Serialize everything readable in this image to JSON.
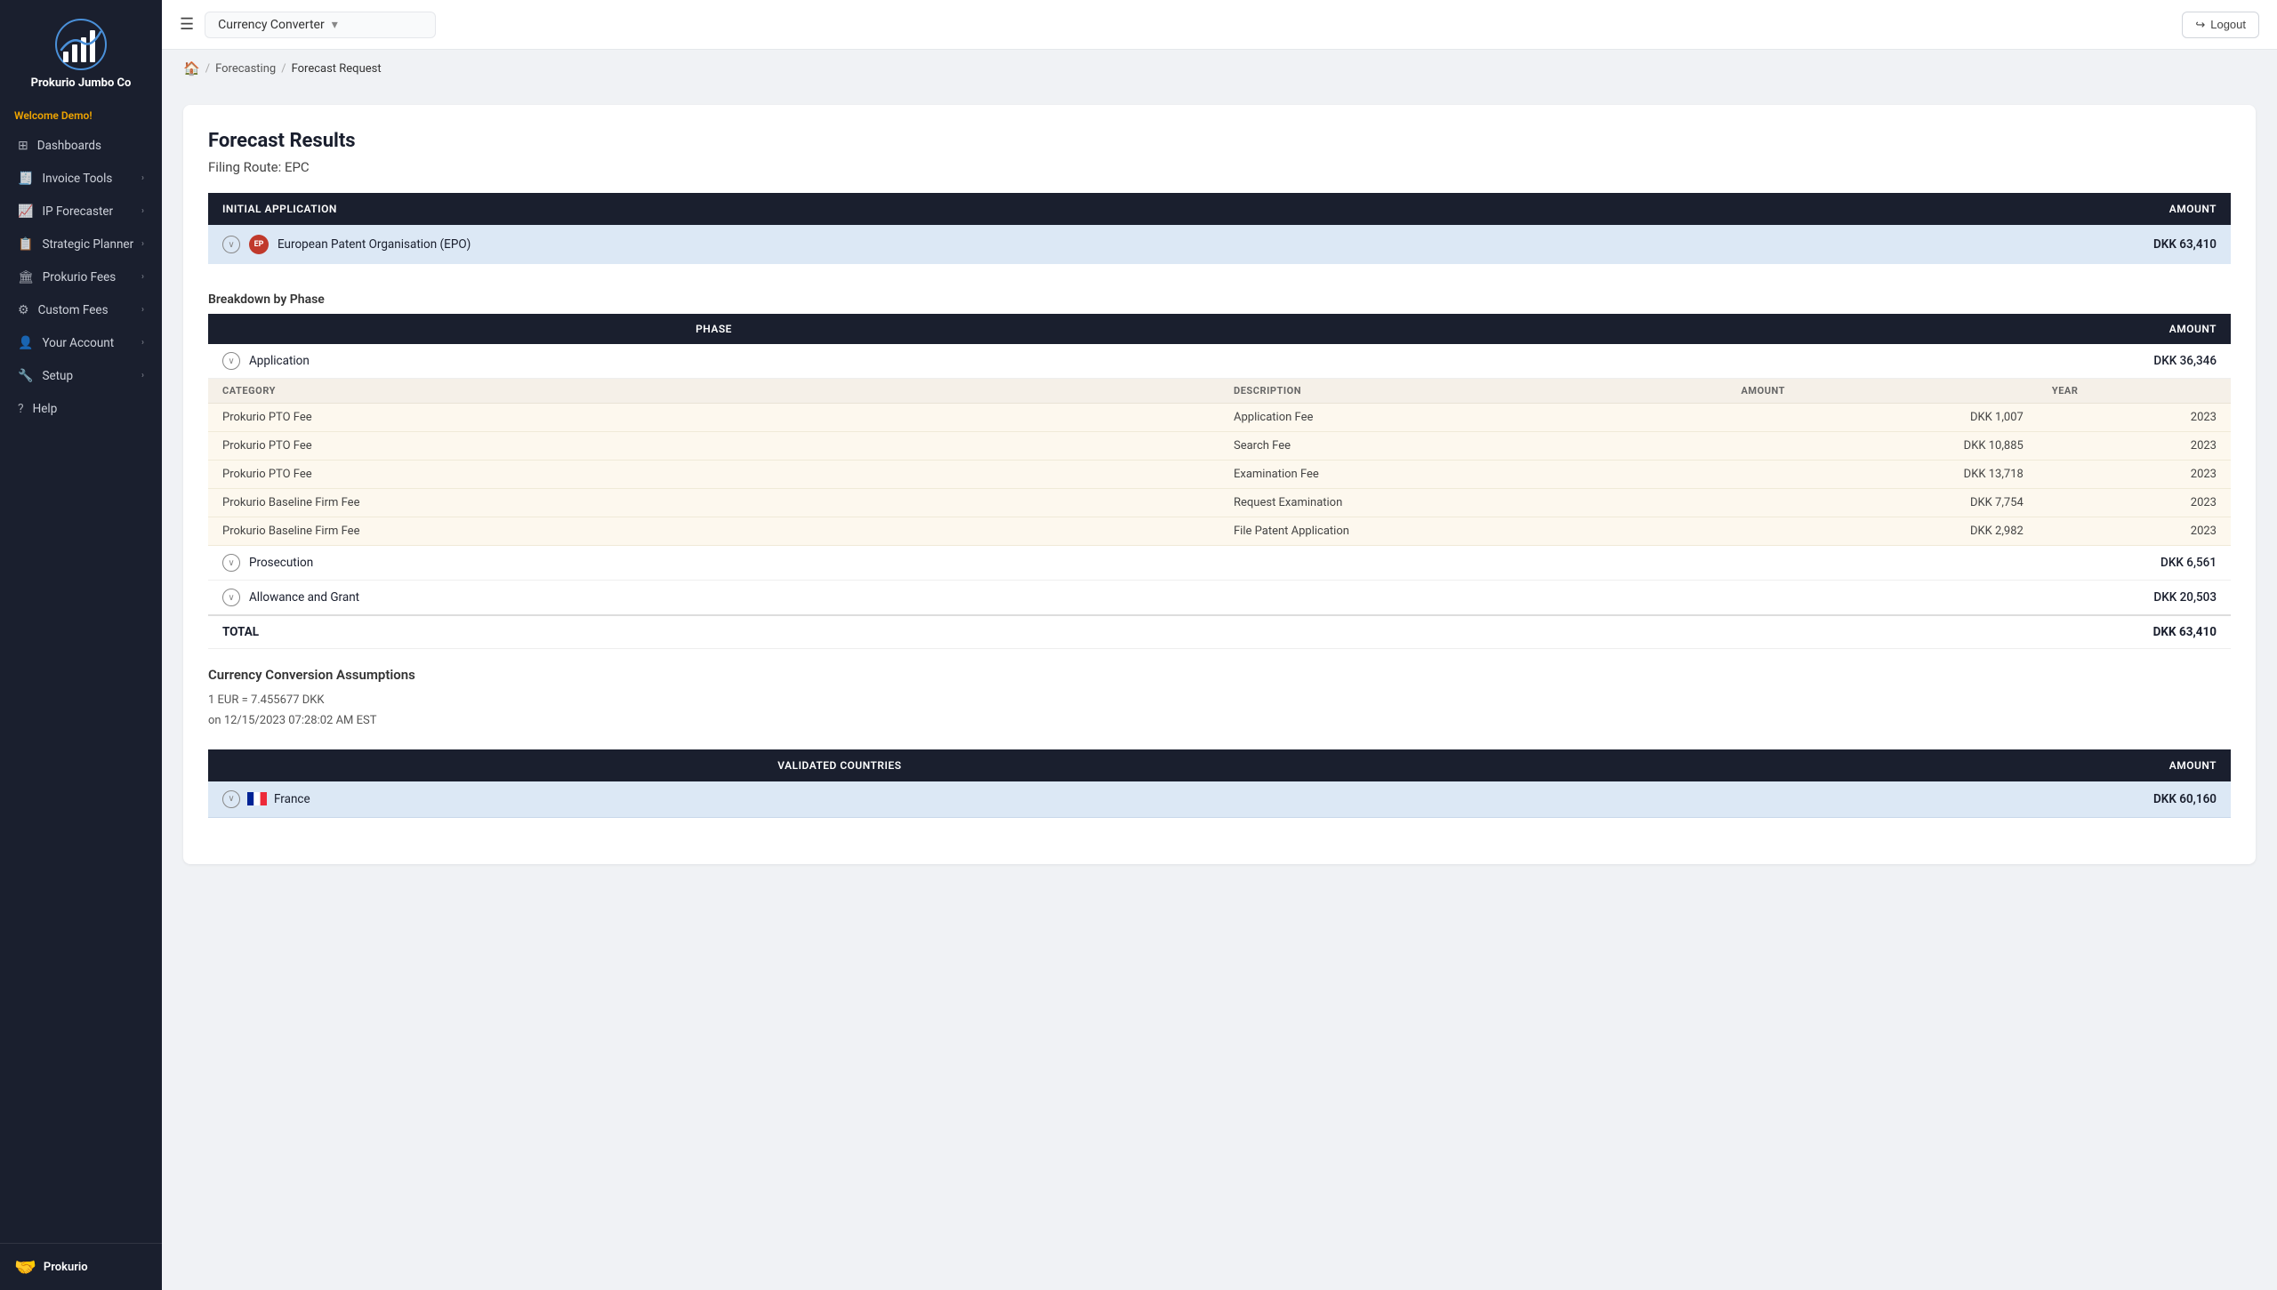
{
  "sidebar": {
    "logo_text": "Prokurio\nJumbo Co",
    "welcome": "Welcome Demo!",
    "items": [
      {
        "id": "dashboards",
        "label": "Dashboards",
        "icon": "⊞",
        "hasChevron": false
      },
      {
        "id": "invoice-tools",
        "label": "Invoice Tools",
        "icon": "🧾",
        "hasChevron": true
      },
      {
        "id": "ip-forecaster",
        "label": "IP Forecaster",
        "icon": "📈",
        "hasChevron": true
      },
      {
        "id": "strategic-planner",
        "label": "Strategic Planner",
        "icon": "📋",
        "hasChevron": true
      },
      {
        "id": "prokurio-fees",
        "label": "Prokurio Fees",
        "icon": "🏛",
        "hasChevron": true
      },
      {
        "id": "custom-fees",
        "label": "Custom Fees",
        "icon": "⚙",
        "hasChevron": true
      },
      {
        "id": "your-account",
        "label": "Your Account",
        "icon": "👤",
        "hasChevron": true
      },
      {
        "id": "setup",
        "label": "Setup",
        "icon": "🔧",
        "hasChevron": true
      },
      {
        "id": "help",
        "label": "Help",
        "icon": "?",
        "hasChevron": false
      }
    ],
    "bottom_label": "Prokurio"
  },
  "topbar": {
    "title": "Currency Converter",
    "logout_label": "Logout"
  },
  "breadcrumb": {
    "home_icon": "🏠",
    "forecasting": "Forecasting",
    "current": "Forecast Request"
  },
  "page": {
    "title": "Forecast Results",
    "filing_route": "Filing Route: EPC",
    "initial_application_header": "INITIAL APPLICATION",
    "amount_header": "AMOUNT",
    "epo_label": "European Patent Organisation (EPO)",
    "epo_amount": "DKK 63,410",
    "breakdown_title": "Breakdown by Phase",
    "phase_header": "PHASE",
    "phase_amount_header": "AMOUNT",
    "category_header": "CATEGORY",
    "description_header": "DESCRIPTION",
    "year_header": "YEAR",
    "phases": [
      {
        "name": "Application",
        "amount": "DKK 36,346",
        "fees": [
          {
            "category": "Prokurio PTO Fee",
            "description": "Application Fee",
            "amount": "DKK 1,007",
            "year": "2023"
          },
          {
            "category": "Prokurio PTO Fee",
            "description": "Search Fee",
            "amount": "DKK 10,885",
            "year": "2023"
          },
          {
            "category": "Prokurio PTO Fee",
            "description": "Examination Fee",
            "amount": "DKK 13,718",
            "year": "2023"
          },
          {
            "category": "Prokurio Baseline Firm Fee",
            "description": "Request Examination",
            "amount": "DKK 7,754",
            "year": "2023"
          },
          {
            "category": "Prokurio Baseline Firm Fee",
            "description": "File Patent Application",
            "amount": "DKK 2,982",
            "year": "2023"
          }
        ]
      },
      {
        "name": "Prosecution",
        "amount": "DKK 6,561",
        "fees": []
      },
      {
        "name": "Allowance and Grant",
        "amount": "DKK 20,503",
        "fees": []
      }
    ],
    "total_label": "TOTAL",
    "total_amount": "DKK 63,410",
    "currency_section": {
      "title": "Currency Conversion Assumptions",
      "rate": "1 EUR = 7.455677 DKK",
      "date": "on 12/15/2023 07:28:02 AM EST"
    },
    "validated_countries_header": "VALIDATED COUNTRIES",
    "validated_amount_header": "AMOUNT",
    "countries": [
      {
        "name": "France",
        "amount": "DKK 60,160"
      }
    ]
  }
}
